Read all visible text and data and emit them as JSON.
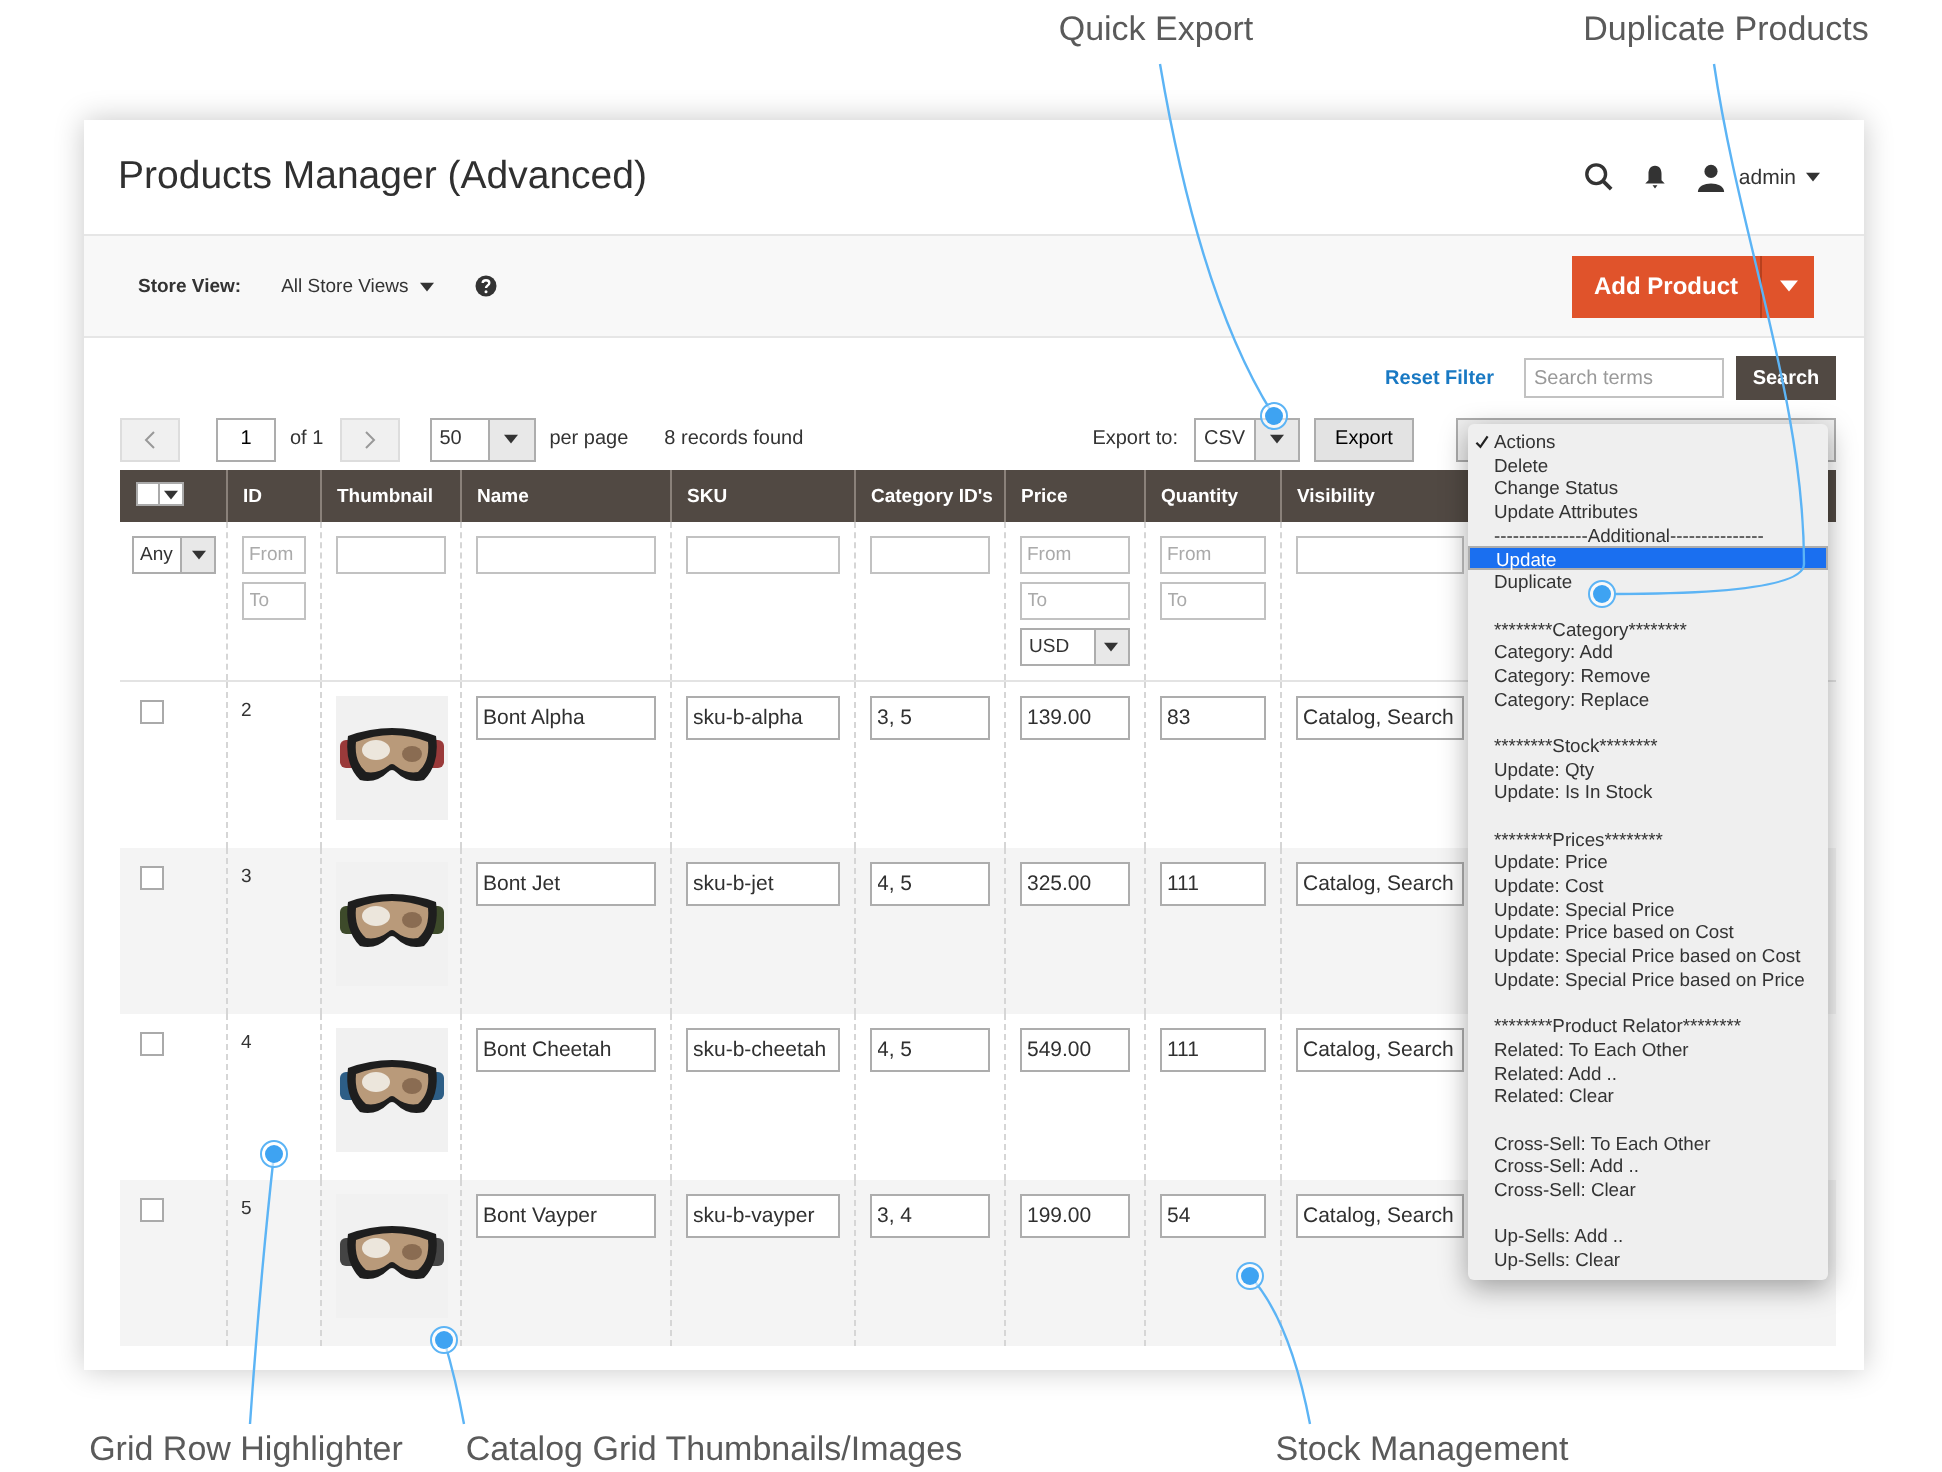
{
  "callouts": [
    {
      "label": "Quick Export"
    },
    {
      "label": "Duplicate Products"
    },
    {
      "label": "Grid Row Highlighter"
    },
    {
      "label": "Catalog Grid Thumbnails/Images"
    },
    {
      "label": "Stock Management"
    }
  ],
  "header": {
    "title": "Products Manager (Advanced)",
    "user": "admin"
  },
  "toolbar": {
    "store_view_label": "Store View:",
    "store_view": "All Store Views",
    "add_button": "Add Product"
  },
  "search": {
    "reset": "Reset Filter",
    "placeholder": "Search terms",
    "button": "Search"
  },
  "pager": {
    "page": "1",
    "of": "of 1",
    "per_page": "50",
    "per_page_label": "per page",
    "records": "8 records found"
  },
  "export": {
    "label": "Export to:",
    "format": "CSV",
    "button": "Export"
  },
  "mass_select": {
    "checked": false
  },
  "columns": [
    "ID",
    "Thumbnail",
    "Name",
    "SKU",
    "Category ID's",
    "Price",
    "Quantity",
    "Visibility"
  ],
  "filters": [
    {
      "kind": "select",
      "value": "Any"
    },
    {
      "kind": "range",
      "placeholders": [
        "From",
        "To"
      ]
    },
    {
      "kind": "text"
    },
    {
      "kind": "text"
    },
    {
      "kind": "text"
    },
    {
      "kind": "text"
    },
    {
      "kind": "range_currency",
      "placeholders": [
        "From",
        "To"
      ],
      "currency": "USD"
    },
    {
      "kind": "range",
      "placeholders": [
        "From",
        "To"
      ]
    },
    {
      "kind": "text"
    }
  ],
  "rows": [
    {
      "checked": false,
      "id": "2",
      "name": "Bont Alpha",
      "sku": "sku-b-alpha",
      "categories": "3, 5",
      "price": "139.00",
      "qty": "83",
      "visibility": "Catalog, Search"
    },
    {
      "checked": false,
      "id": "3",
      "name": "Bont Jet",
      "sku": "sku-b-jet",
      "categories": "4, 5",
      "price": "325.00",
      "qty": "111",
      "visibility": "Catalog, Search"
    },
    {
      "checked": false,
      "id": "4",
      "name": "Bont Cheetah",
      "sku": "sku-b-cheetah",
      "categories": "4, 5",
      "price": "549.00",
      "qty": "111",
      "visibility": "Catalog, Search"
    },
    {
      "checked": false,
      "id": "5",
      "name": "Bont Vayper",
      "sku": "sku-b-vayper",
      "categories": "3, 4",
      "price": "199.00",
      "qty": "54",
      "visibility": "Catalog, Search"
    }
  ],
  "actions_menu": [
    {
      "items": [
        {
          "label": "Actions",
          "checked": true,
          "selected": false
        },
        {
          "label": "Delete",
          "checked": false,
          "selected": false
        },
        {
          "label": "Change Status",
          "checked": false,
          "selected": false
        },
        {
          "label": "Update Attributes",
          "checked": false,
          "selected": false
        },
        {
          "label": "---------------Additional---------------",
          "checked": false,
          "selected": false
        },
        {
          "label": "Update",
          "checked": false,
          "selected": true
        },
        {
          "label": "Duplicate",
          "checked": false,
          "selected": false
        }
      ]
    },
    {
      "items": [
        {
          "label": "********Category********",
          "checked": false,
          "selected": false
        },
        {
          "label": "Category: Add",
          "checked": false,
          "selected": false
        },
        {
          "label": "Category: Remove",
          "checked": false,
          "selected": false
        },
        {
          "label": "Category: Replace",
          "checked": false,
          "selected": false
        }
      ]
    },
    {
      "items": [
        {
          "label": "********Stock********",
          "checked": false,
          "selected": false
        },
        {
          "label": "Update: Qty",
          "checked": false,
          "selected": false
        },
        {
          "label": "Update: Is In Stock",
          "checked": false,
          "selected": false
        }
      ]
    },
    {
      "items": [
        {
          "label": "********Prices********",
          "checked": false,
          "selected": false
        },
        {
          "label": "Update: Price",
          "checked": false,
          "selected": false
        },
        {
          "label": "Update: Cost",
          "checked": false,
          "selected": false
        },
        {
          "label": "Update: Special Price",
          "checked": false,
          "selected": false
        },
        {
          "label": "Update: Price based on Cost",
          "checked": false,
          "selected": false
        },
        {
          "label": "Update: Special Price based on Cost",
          "checked": false,
          "selected": false
        },
        {
          "label": "Update: Special Price based on Price",
          "checked": false,
          "selected": false
        }
      ]
    },
    {
      "items": [
        {
          "label": "********Product Relator********",
          "checked": false,
          "selected": false
        },
        {
          "label": "Related: To Each Other",
          "checked": false,
          "selected": false
        },
        {
          "label": "Related: Add ..",
          "checked": false,
          "selected": false
        },
        {
          "label": "Related: Clear",
          "checked": false,
          "selected": false
        }
      ]
    },
    {
      "items": [
        {
          "label": "Cross-Sell: To Each Other",
          "checked": false,
          "selected": false
        },
        {
          "label": "Cross-Sell: Add ..",
          "checked": false,
          "selected": false
        },
        {
          "label": "Cross-Sell: Clear",
          "checked": false,
          "selected": false
        }
      ]
    },
    {
      "items": [
        {
          "label": "Up-Sells: Add ..",
          "checked": false,
          "selected": false
        },
        {
          "label": "Up-Sells: Clear",
          "checked": false,
          "selected": false
        }
      ]
    }
  ]
}
